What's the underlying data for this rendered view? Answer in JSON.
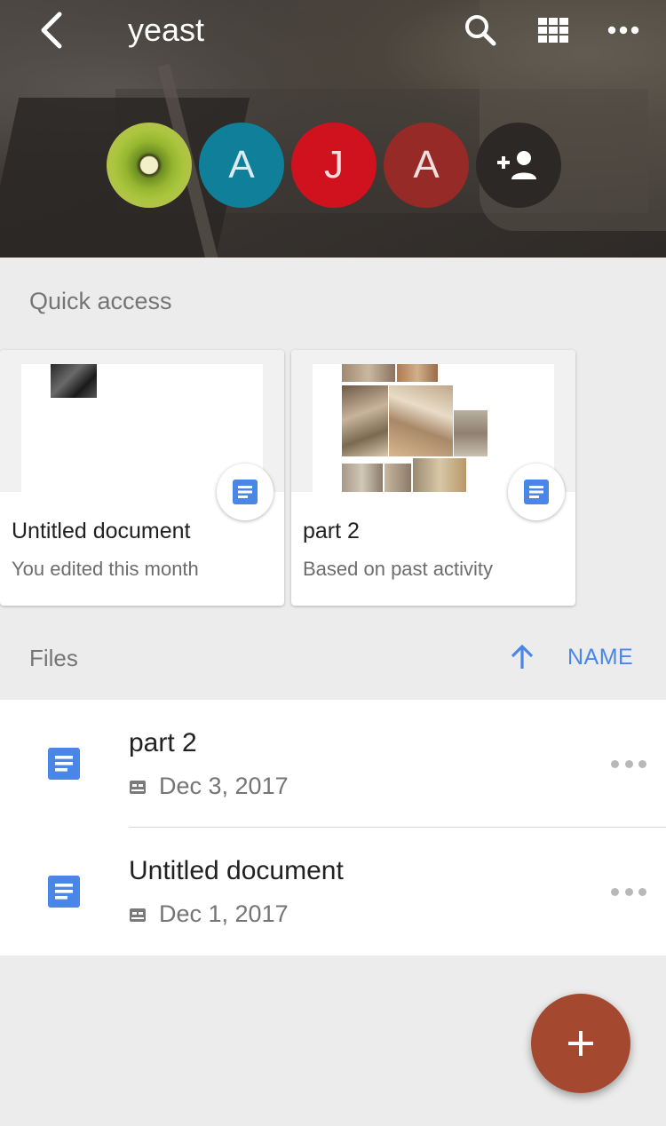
{
  "header": {
    "title": "yeast",
    "back_icon": "chevron-left-icon",
    "actions": [
      "search-icon",
      "grid-view-icon",
      "more-horizontal-icon"
    ]
  },
  "members": [
    {
      "kind": "photo",
      "initial": "",
      "color": "#8fb234"
    },
    {
      "kind": "letter",
      "initial": "A",
      "color": "#0f7f9a"
    },
    {
      "kind": "letter",
      "initial": "J",
      "color": "#d0121f"
    },
    {
      "kind": "letter",
      "initial": "A",
      "color": "#962a26"
    },
    {
      "kind": "add",
      "icon": "add-person-icon",
      "color": "#2b2826"
    }
  ],
  "quick_access": {
    "label": "Quick access",
    "cards": [
      {
        "title": "Untitled document",
        "reason": "You edited this month",
        "icon": "docs-icon"
      },
      {
        "title": "part 2",
        "reason": "Based on past activity",
        "icon": "docs-icon"
      }
    ]
  },
  "files": {
    "label": "Files",
    "sort_label": "NAME",
    "sort_icon": "arrow-up-icon",
    "items": [
      {
        "name": "part 2",
        "date": "Dec 3, 2017",
        "icon": "docs-icon",
        "meta_icon": "shared-drive-icon"
      },
      {
        "name": "Untitled document",
        "date": "Dec 1, 2017",
        "icon": "docs-icon",
        "meta_icon": "shared-drive-icon"
      }
    ]
  },
  "fab": {
    "icon": "plus-icon"
  },
  "colors": {
    "accent": "#4a86e8",
    "fab": "#a4492f",
    "doc_blue": "#4a86e8"
  }
}
